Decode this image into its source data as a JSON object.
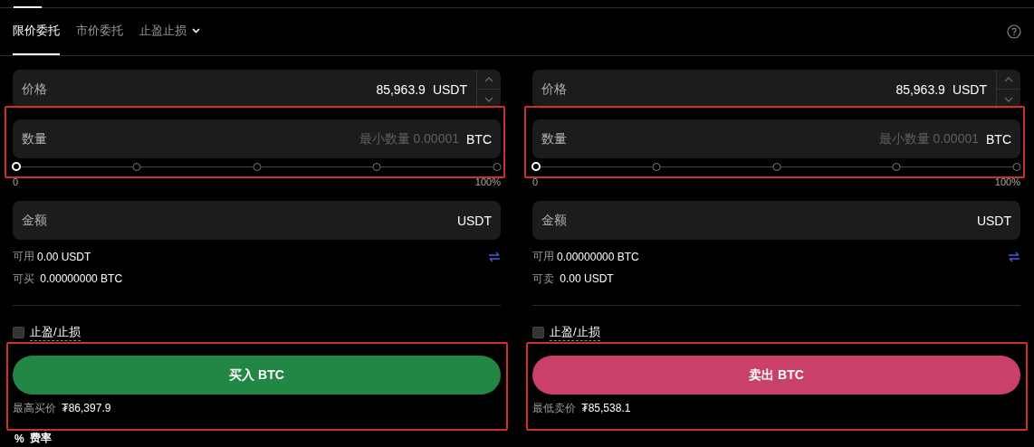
{
  "order_types": [
    {
      "label": "限价委托",
      "selected": true,
      "kind": "tab"
    },
    {
      "label": "市价委托",
      "selected": false,
      "kind": "tab"
    },
    {
      "label": "止盈止损",
      "selected": false,
      "kind": "dropdown"
    }
  ],
  "panels": [
    {
      "kind": "buy",
      "price": {
        "label": "价格",
        "value": "85,963.9",
        "unit": "USDT"
      },
      "quantity": {
        "label": "数量",
        "placeholder": "最小数量 0.00001",
        "unit": "BTC",
        "highlighted": true
      },
      "slider": {
        "level": 0,
        "min_label": "0",
        "max_label": "100%"
      },
      "amount": {
        "label": "金额",
        "unit": "USDT"
      },
      "balances": [
        {
          "label": "可用",
          "value": "0.00 USDT"
        },
        {
          "label": "可买",
          "value": "0.00000000 BTC"
        }
      ],
      "tpsl": {
        "label": "止盈/止损",
        "checked": false
      },
      "action": {
        "label": "买入 BTC",
        "highlighted": true
      },
      "best_price": {
        "label": "最高买价",
        "value": "₮86,397.9"
      }
    },
    {
      "kind": "sell",
      "price": {
        "label": "价格",
        "value": "85,963.9",
        "unit": "USDT"
      },
      "quantity": {
        "label": "数量",
        "placeholder": "最小数量 0.00001",
        "unit": "BTC",
        "highlighted": true
      },
      "slider": {
        "level": 0,
        "min_label": "0",
        "max_label": "100%"
      },
      "amount": {
        "label": "金额",
        "unit": "USDT"
      },
      "balances": [
        {
          "label": "可用",
          "value": "0.00000000 BTC"
        },
        {
          "label": "可卖",
          "value": "0.00 USDT"
        }
      ],
      "tpsl": {
        "label": "止盈/止损",
        "checked": false
      },
      "action": {
        "label": "卖出 BTC",
        "highlighted": true
      },
      "best_price": {
        "label": "最低卖价",
        "value": "₮85,538.1"
      }
    }
  ],
  "fee": {
    "icon": "%",
    "label": "费率"
  }
}
